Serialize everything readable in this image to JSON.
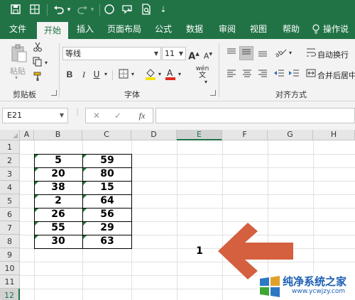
{
  "quick_access": {
    "icons": [
      "save-icon",
      "grid-icon",
      "undo-icon",
      "redo-icon",
      "circle-icon",
      "shape-icon",
      "print-preview-icon",
      "customize-icon"
    ]
  },
  "ribbon_tabs": [
    "文件",
    "开始",
    "插入",
    "页面布局",
    "公式",
    "数据",
    "审阅",
    "视图",
    "帮助",
    "操作说"
  ],
  "active_tab": "开始",
  "clipboard": {
    "paste_label": "粘贴",
    "group_label": "剪贴板"
  },
  "font": {
    "name": "等线",
    "size": "11",
    "grow_icon": "A",
    "shrink_icon": "A",
    "bold": "B",
    "italic": "I",
    "underline": "U",
    "underline_dd": "▾",
    "wen": "wén",
    "group_label": "字体"
  },
  "alignment": {
    "wrap_label": "自动换行",
    "merge_label": "合并后居中",
    "group_label": "对齐方式"
  },
  "formula_bar": {
    "name_box": "E21",
    "cancel": "✕",
    "confirm": "✓",
    "fx": "fx",
    "formula": ""
  },
  "sheet": {
    "columns": [
      "A",
      "B",
      "C",
      "D",
      "E",
      "F",
      "G",
      "H"
    ],
    "selected_column": "E",
    "rows": [
      "1",
      "2",
      "3",
      "4",
      "5",
      "6",
      "7",
      "8",
      "9",
      "10",
      "11",
      "12"
    ],
    "selected_row": "12",
    "col_b": [
      "5",
      "20",
      "38",
      "2",
      "26",
      "55",
      "30"
    ],
    "col_c": [
      "59",
      "80",
      "15",
      "64",
      "56",
      "29",
      "63"
    ],
    "e8": "1"
  },
  "watermark": {
    "title": "纯净系统之家",
    "url": "www.ycwjzy.com"
  },
  "colors": {
    "brand": "#217346",
    "arrow": "#d4603f"
  }
}
